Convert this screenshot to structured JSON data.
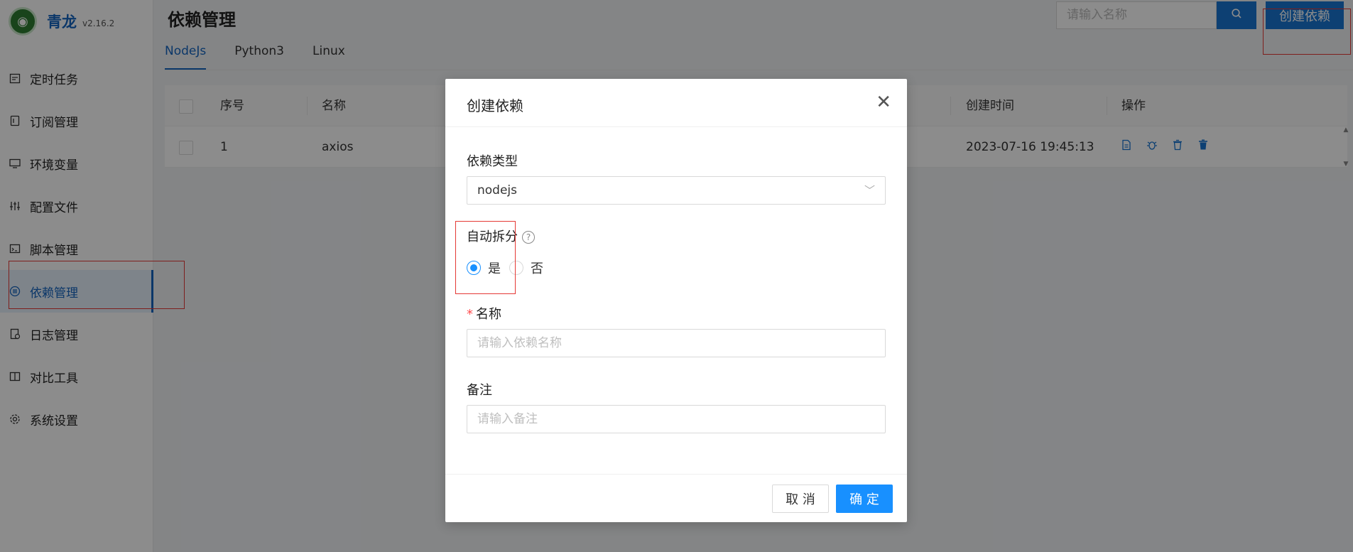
{
  "app": {
    "name": "青龙",
    "version": "v2.16.2"
  },
  "sidebar": {
    "items": [
      {
        "label": "定时任务",
        "icon": "calendar-icon"
      },
      {
        "label": "订阅管理",
        "icon": "subscription-icon"
      },
      {
        "label": "环境变量",
        "icon": "monitor-icon"
      },
      {
        "label": "配置文件",
        "icon": "sliders-icon"
      },
      {
        "label": "脚本管理",
        "icon": "code-window-icon"
      },
      {
        "label": "依赖管理",
        "icon": "list-circle-icon"
      },
      {
        "label": "日志管理",
        "icon": "log-icon"
      },
      {
        "label": "对比工具",
        "icon": "diff-icon"
      },
      {
        "label": "系统设置",
        "icon": "gear-icon"
      }
    ],
    "active_index": 5
  },
  "header": {
    "title": "依赖管理",
    "search_placeholder": "请输入名称",
    "create_label": "创建依赖"
  },
  "tabs": [
    {
      "label": "NodeJs"
    },
    {
      "label": "Python3"
    },
    {
      "label": "Linux"
    }
  ],
  "table": {
    "headers": {
      "index": "序号",
      "name": "名称",
      "created": "创建时间",
      "actions": "操作"
    },
    "rows": [
      {
        "index": "1",
        "name": "axios",
        "created": "2023-07-16 19:45:13"
      }
    ]
  },
  "modal": {
    "title": "创建依赖",
    "type_label": "依赖类型",
    "type_value": "nodejs",
    "auto_split_label": "自动拆分",
    "auto_split_yes": "是",
    "auto_split_no": "否",
    "name_label": "名称",
    "name_placeholder": "请输入依赖名称",
    "remark_label": "备注",
    "remark_placeholder": "请输入备注",
    "cancel_label": "取 消",
    "ok_label": "确 定"
  },
  "colors": {
    "primary": "#1976d2",
    "accent": "#1890ff",
    "highlight": "#e53935"
  }
}
